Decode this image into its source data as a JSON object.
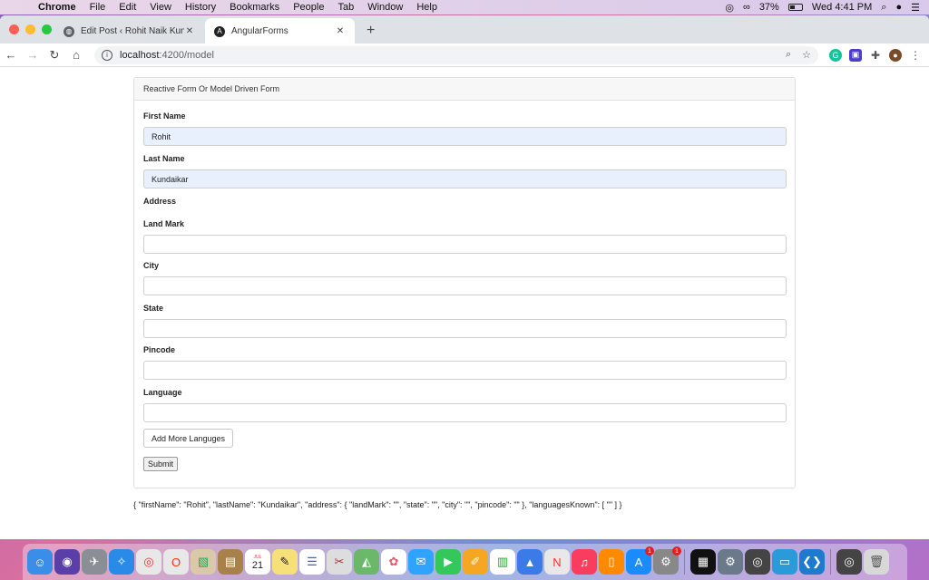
{
  "menubar": {
    "app_name": "Chrome",
    "items": [
      "File",
      "Edit",
      "View",
      "History",
      "Bookmarks",
      "People",
      "Tab",
      "Window",
      "Help"
    ],
    "battery": "37%",
    "clock": "Wed 4:41 PM"
  },
  "browser": {
    "tabs": [
      {
        "title": "Edit Post ‹ Rohit Naik Kundaikar",
        "active": false
      },
      {
        "title": "AngularForms",
        "active": true
      }
    ],
    "url_host": "localhost",
    "url_path": ":4200/model"
  },
  "form": {
    "header": "Reactive Form Or Model Driven Form",
    "first_name_label": "First Name",
    "first_name_value": "Rohit",
    "last_name_label": "Last Name",
    "last_name_value": "Kundaikar",
    "address_label": "Address",
    "landmark_label": "Land Mark",
    "landmark_value": "",
    "city_label": "City",
    "city_value": "",
    "state_label": "State",
    "state_value": "",
    "pincode_label": "Pincode",
    "pincode_value": "",
    "language_label": "Language",
    "language_value": "",
    "add_languages_button": "Add More Languges",
    "submit_button": "Submit"
  },
  "json_output": "{ \"firstName\": \"Rohit\", \"lastName\": \"Kundaikar\", \"address\": { \"landMark\": \"\", \"state\": \"\", \"city\": \"\", \"pincode\": \"\" }, \"languagesKnown\": [ \"\" ] }",
  "dock": {
    "calendar_month": "JUL",
    "calendar_day": "21",
    "app_store_badge": "1",
    "system_prefs_badge": "1"
  }
}
